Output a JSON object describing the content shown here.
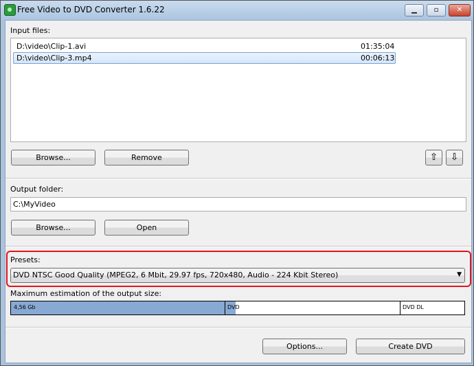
{
  "window": {
    "title": "Free Video to DVD Converter 1.6.22",
    "minimize": "▁",
    "maximize": "▫",
    "close": "✕"
  },
  "input": {
    "label": "Input files:",
    "files": [
      {
        "path": "D:\\video\\Clip-1.avi",
        "duration": "01:35:04"
      },
      {
        "path": "D:\\video\\Clip-3.mp4",
        "duration": "00:06:13"
      }
    ],
    "browse": "Browse...",
    "remove": "Remove",
    "up": "⇧",
    "down": "⇩"
  },
  "output": {
    "label": "Output folder:",
    "value": "C:\\MyVideo",
    "browse": "Browse...",
    "open": "Open"
  },
  "presets": {
    "label": "Presets:",
    "selected": "DVD NTSC Good Quality (MPEG2, 6 Mbit, 29.97 fps, 720x480, Audio - 224 Kbit Stereo)",
    "arrow": "▼"
  },
  "estimation": {
    "label": "Maximum estimation of the output size:",
    "size": "4,56 Gb",
    "fill_fraction": 0.495,
    "markers": [
      "DVD",
      "DVD DL"
    ]
  },
  "footer": {
    "options": "Options...",
    "create": "Create DVD"
  }
}
